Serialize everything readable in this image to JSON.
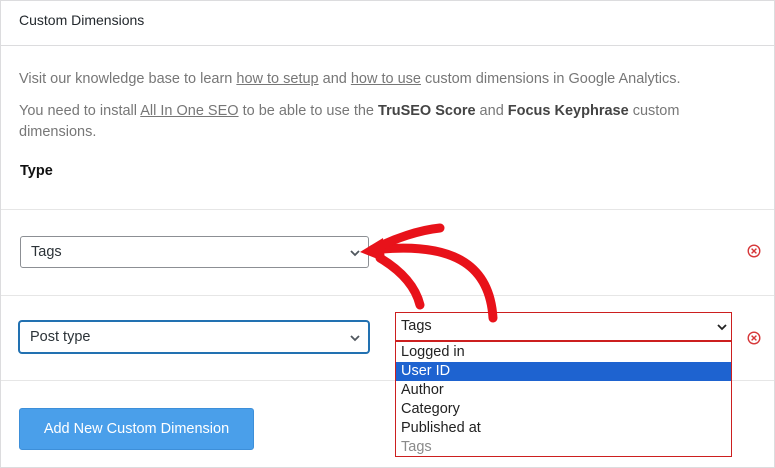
{
  "panel": {
    "title": "Custom Dimensions"
  },
  "intro": {
    "p1_prefix": "Visit our knowledge base to learn ",
    "p1_link1": "how to setup",
    "p1_mid": " and ",
    "p1_link2": "how to use",
    "p1_suffix": " custom dimensions in Google Analytics.",
    "p2_prefix": "You need to install ",
    "p2_link": "All In One SEO",
    "p2_mid1": " to be able to use the ",
    "p2_bold1": "TruSEO Score",
    "p2_mid2": " and ",
    "p2_bold2": "Focus Keyphrase",
    "p2_suffix": " custom dimensions."
  },
  "type_label": "Type",
  "rows": [
    {
      "value": "Tags"
    },
    {
      "value": "Post type"
    }
  ],
  "open_select": {
    "value": "Tags",
    "options": [
      {
        "label": "Logged in",
        "state": "normal"
      },
      {
        "label": "User ID",
        "state": "selected"
      },
      {
        "label": "Author",
        "state": "normal"
      },
      {
        "label": "Category",
        "state": "normal"
      },
      {
        "label": "Published at",
        "state": "normal"
      },
      {
        "label": "Tags",
        "state": "disabled"
      }
    ]
  },
  "add_button": "Add New Custom Dimension",
  "colors": {
    "accent": "#4a9fea",
    "remove": "#d63638",
    "annotation": "#e8121a",
    "option_selected": "#1e63d0"
  },
  "icons": {
    "remove": "remove-circle-icon",
    "chevron": "chevron-down-icon",
    "annotation": "curved-arrow-annotation"
  }
}
